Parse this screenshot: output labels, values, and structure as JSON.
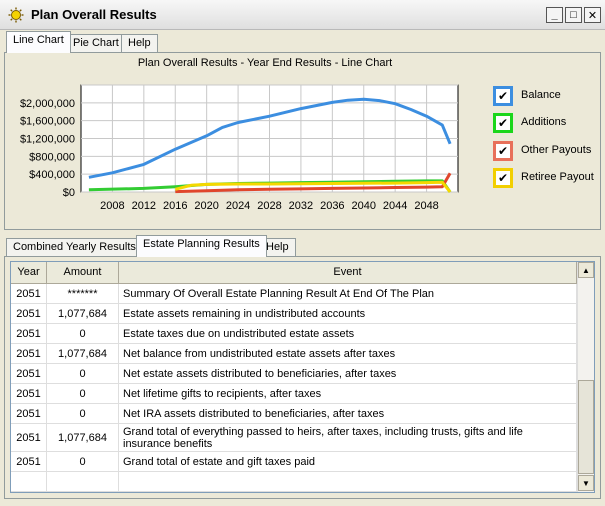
{
  "window": {
    "title": "Plan Overall Results"
  },
  "top_tabs": [
    "Line Chart",
    "Pie Chart",
    "Help"
  ],
  "bottom_tabs": [
    "Combined Yearly Results",
    "Estate Planning Results",
    "Help"
  ],
  "chart_data": {
    "type": "line",
    "title": "Plan Overall Results - Year End Results - Line Chart",
    "xlabel": "",
    "ylabel": "",
    "xlim": [
      2004,
      2052
    ],
    "ylim": [
      0,
      2400000
    ],
    "x_ticks": [
      2008,
      2012,
      2016,
      2020,
      2024,
      2028,
      2032,
      2036,
      2040,
      2044,
      2048
    ],
    "x_tick_labels": [
      "2008",
      "2012",
      "2016",
      "2020",
      "2024",
      "2028",
      "2032",
      "2036",
      "2040",
      "2044",
      "2048"
    ],
    "y_ticks": [
      0,
      400000,
      800000,
      1200000,
      1600000,
      2000000
    ],
    "y_tick_labels": [
      "$0",
      "$400,000",
      "$800,000",
      "$1,200,000",
      "$1,600,000",
      "$2,000,000"
    ],
    "grid": true,
    "legend_position": "right",
    "series": [
      {
        "name": "Balance",
        "color": "#3c8ee0",
        "x": [
          2005,
          2008,
          2012,
          2016,
          2020,
          2022,
          2024,
          2028,
          2032,
          2036,
          2038,
          2040,
          2042,
          2044,
          2046,
          2048,
          2050,
          2051
        ],
        "y": [
          330000,
          430000,
          620000,
          960000,
          1260000,
          1450000,
          1560000,
          1700000,
          1870000,
          2010000,
          2060000,
          2080000,
          2050000,
          1980000,
          1850000,
          1700000,
          1500000,
          1080000
        ]
      },
      {
        "name": "Additions",
        "color": "#33cc33",
        "x": [
          2005,
          2012,
          2016,
          2020,
          2024,
          2028,
          2032,
          2036,
          2040,
          2044,
          2048,
          2050,
          2051
        ],
        "y": [
          50000,
          80000,
          120000,
          170000,
          190000,
          200000,
          210000,
          220000,
          230000,
          240000,
          250000,
          250000,
          0
        ]
      },
      {
        "name": "Other Payouts",
        "color": "#e0462c",
        "x": [
          2016,
          2020,
          2024,
          2028,
          2032,
          2036,
          2040,
          2044,
          2048,
          2050,
          2051
        ],
        "y": [
          10000,
          30000,
          50000,
          60000,
          70000,
          80000,
          90000,
          100000,
          110000,
          120000,
          420000
        ]
      },
      {
        "name": "Retiree Payout",
        "color": "#f5d800",
        "x": [
          2016,
          2018,
          2020,
          2024,
          2028,
          2032,
          2036,
          2040,
          2044,
          2048,
          2050,
          2051
        ],
        "y": [
          60000,
          150000,
          170000,
          180000,
          180000,
          185000,
          190000,
          195000,
          200000,
          210000,
          220000,
          0
        ]
      }
    ]
  },
  "legend": [
    {
      "label": "Balance",
      "color": "#3c8ee0",
      "checked": true
    },
    {
      "label": "Additions",
      "color": "#1bd61b",
      "checked": true
    },
    {
      "label": "Other Payouts",
      "color": "#e8705a",
      "checked": true
    },
    {
      "label": "Retiree Payout",
      "color": "#f2cf00",
      "checked": true
    }
  ],
  "check_glyph": "✔",
  "grid": {
    "headers": [
      "Year",
      "Amount",
      "Event"
    ],
    "rows": [
      {
        "year": "2051",
        "amount": "*******",
        "event": "Summary Of Overall Estate Planning Result At End Of The Plan"
      },
      {
        "year": "2051",
        "amount": "1,077,684",
        "event": "Estate assets remaining in undistributed accounts"
      },
      {
        "year": "2051",
        "amount": "0",
        "event": "Estate taxes due on undistributed estate assets"
      },
      {
        "year": "2051",
        "amount": "1,077,684",
        "event": "Net balance from undistributed estate assets after taxes"
      },
      {
        "year": "2051",
        "amount": "0",
        "event": "Net estate assets distributed to beneficiaries, after taxes"
      },
      {
        "year": "2051",
        "amount": "0",
        "event": "Net lifetime gifts to recipients, after taxes"
      },
      {
        "year": "2051",
        "amount": "0",
        "event": "Net IRA assets distributed to beneficiaries, after taxes"
      },
      {
        "year": "2051",
        "amount": "1,077,684",
        "event": "Grand total of everything passed to heirs, after taxes, including trusts, gifts and life insurance benefits"
      },
      {
        "year": "2051",
        "amount": "0",
        "event": "Grand total of estate and gift taxes paid"
      },
      {
        "year": "",
        "amount": "",
        "event": ""
      }
    ]
  },
  "icons": {
    "window": "sun-icon",
    "minimize": "minimize-icon",
    "maximize": "maximize-icon",
    "close": "close-icon",
    "scroll_up": "scroll-up-arrow-icon",
    "scroll_down": "scroll-down-arrow-icon"
  },
  "glyphs": {
    "minimize": "_",
    "maximize": "□",
    "close": "✕",
    "up": "▲",
    "down": "▼"
  }
}
